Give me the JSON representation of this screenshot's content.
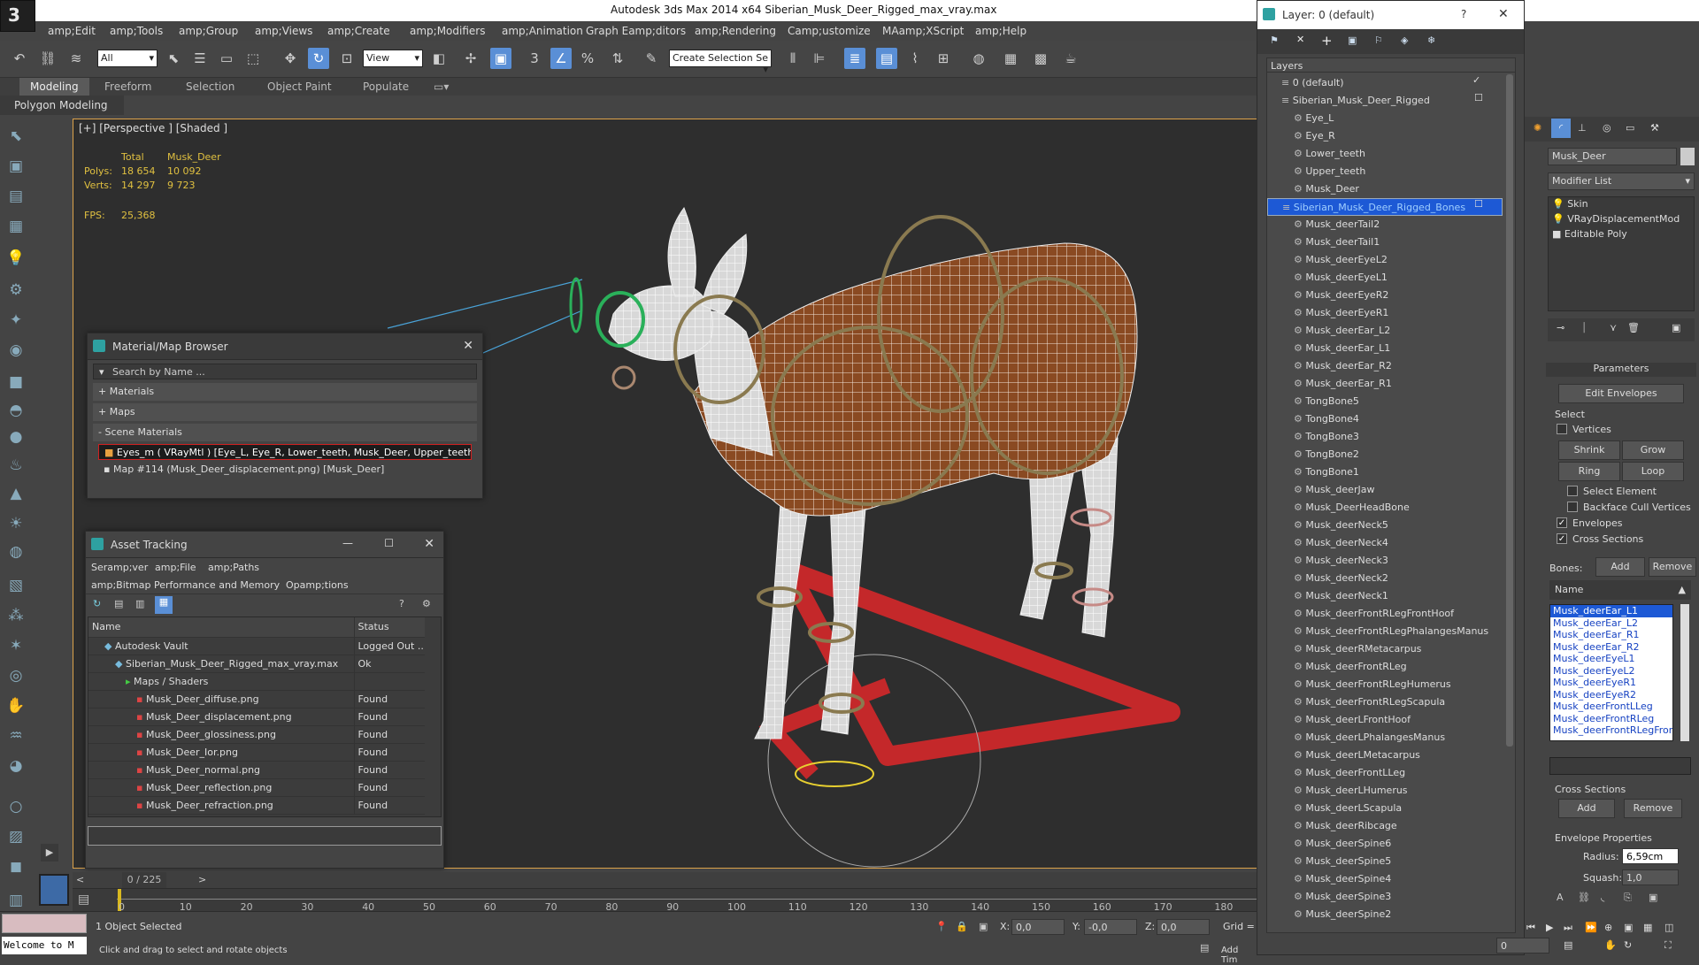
{
  "title": "Autodesk 3ds Max  2014 x64    Siberian_Musk_Deer_Rigged_max_vray.max",
  "logo": "3",
  "menu": [
    "amp;Edit",
    "amp;Tools",
    "amp;Group",
    "amp;Views",
    "amp;Create",
    "amp;Modifiers",
    "amp;Animation",
    "Graph Eamp;ditors",
    "amp;Rendering",
    "Camp;ustomize",
    "MAamp;XScript",
    "amp;Help"
  ],
  "toolbar": {
    "filter": "All",
    "refcoord": "View",
    "selset": "Create Selection Se",
    "snap3": "3",
    "snap_pct": "%"
  },
  "ribbon": {
    "tabs": [
      "Modeling",
      "Freeform",
      "Selection",
      "Object Paint",
      "Populate"
    ],
    "sub": "Polygon Modeling"
  },
  "viewport": {
    "label": "[+] [Perspective ] [Shaded ]",
    "stats": {
      "h_total": "Total",
      "h_obj": "Musk_Deer",
      "polys_label": "Polys:",
      "polys_total": "18 654",
      "polys_obj": "10 092",
      "verts_label": "Verts:",
      "verts_total": "14 297",
      "verts_obj": "9 723",
      "fps_label": "FPS:",
      "fps": "25,368"
    }
  },
  "material_browser": {
    "title": "Material/Map Browser",
    "search": "Search by Name ...",
    "materials": "+ Materials",
    "maps": "+ Maps",
    "scene": "- Scene Materials",
    "items": [
      "Eyes_m  ( VRayMtl ) [Eye_L, Eye_R, Lower_teeth, Musk_Deer, Upper_teeth]",
      "Map #114 (Musk_Deer_displacement.png) [Musk_Deer]"
    ]
  },
  "asset_tracking": {
    "title": "Asset Tracking",
    "menu": [
      "Seramp;ver",
      "amp;File",
      "amp;Paths",
      "amp;Bitmap Performance and Memory",
      "Opamp;tions"
    ],
    "col_name": "Name",
    "col_status": "Status",
    "rows": [
      {
        "name": "Autodesk Vault",
        "status": "Logged Out ..",
        "level": 1
      },
      {
        "name": "Siberian_Musk_Deer_Rigged_max_vray.max",
        "status": "Ok",
        "level": 2
      },
      {
        "name": "Maps / Shaders",
        "status": "",
        "level": 3
      },
      {
        "name": "Musk_Deer_diffuse.png",
        "status": "Found",
        "level": 4
      },
      {
        "name": "Musk_Deer_displacement.png",
        "status": "Found",
        "level": 4
      },
      {
        "name": "Musk_Deer_glossiness.png",
        "status": "Found",
        "level": 4
      },
      {
        "name": "Musk_Deer_Ior.png",
        "status": "Found",
        "level": 4
      },
      {
        "name": "Musk_Deer_normal.png",
        "status": "Found",
        "level": 4
      },
      {
        "name": "Musk_Deer_reflection.png",
        "status": "Found",
        "level": 4
      },
      {
        "name": "Musk_Deer_refraction.png",
        "status": "Found",
        "level": 4
      }
    ]
  },
  "timeline": {
    "frame": "0 / 225",
    "ticks": [
      "0",
      "10",
      "20",
      "30",
      "40",
      "50",
      "60",
      "70",
      "80",
      "90",
      "100",
      "110",
      "120",
      "130",
      "140",
      "150",
      "160",
      "170",
      "180"
    ]
  },
  "status": {
    "welcome": "Welcome to M",
    "selected": "1 Object Selected",
    "hint": "Click and drag to select and rotate objects",
    "x_label": "X:",
    "x": "0,0",
    "y_label": "Y:",
    "y": "-0,0",
    "z_label": "Z:",
    "z": "0,0",
    "grid": "Grid =",
    "addtime": "Add Tim",
    "frame_field": "0"
  },
  "layer_window": {
    "title": "Layer: 0 (default)",
    "help": "?",
    "header": "Layers",
    "rows": [
      "0 (default)",
      "Siberian_Musk_Deer_Rigged",
      "Eye_L",
      "Eye_R",
      "Lower_teeth",
      "Upper_teeth",
      "Musk_Deer",
      "Siberian_Musk_Deer_Rigged_Bones",
      "Musk_deerTail2",
      "Musk_deerTail1",
      "Musk_deerEyeL2",
      "Musk_deerEyeL1",
      "Musk_deerEyeR2",
      "Musk_deerEyeR1",
      "Musk_deerEar_L2",
      "Musk_deerEar_L1",
      "Musk_deerEar_R2",
      "Musk_deerEar_R1",
      "TongBone5",
      "TongBone4",
      "TongBone3",
      "TongBone2",
      "TongBone1",
      "Musk_deerJaw",
      "Musk_DeerHeadBone",
      "Musk_deerNeck5",
      "Musk_deerNeck4",
      "Musk_deerNeck3",
      "Musk_deerNeck2",
      "Musk_deerNeck1",
      "Musk_deerFrontRLegFrontHoof",
      "Musk_deerFrontRLegPhalangesManus",
      "Musk_deerRMetacarpus",
      "Musk_deerFrontRLeg",
      "Musk_deerFrontRLegHumerus",
      "Musk_deerFrontRLegScapula",
      "Musk_deerLFrontHoof",
      "Musk_deerLPhalangesManus",
      "Musk_deerLMetacarpus",
      "Musk_deerFrontLLeg",
      "Musk_deerLHumerus",
      "Musk_deerLScapula",
      "Musk_deerRibcage",
      "Musk_deerSpine6",
      "Musk_deerSpine5",
      "Musk_deerSpine4",
      "Musk_deerSpine3",
      "Musk_deerSpine2"
    ]
  },
  "command_panel": {
    "object_name": "Musk_Deer",
    "modlist": "Modifier List",
    "stack": [
      "Skin",
      "VRayDisplacementMod",
      "Editable Poly"
    ],
    "params": "Parameters",
    "edit_env": "Edit Envelopes",
    "select": "Select",
    "vertices": "Vertices",
    "shrink": "Shrink",
    "grow": "Grow",
    "ring": "Ring",
    "loop": "Loop",
    "sel_element": "Select Element",
    "backface": "Backface Cull Vertices",
    "envelopes": "Envelopes",
    "cross_sections": "Cross Sections",
    "bones": "Bones:",
    "add": "Add",
    "remove": "Remove",
    "name_col": "Name",
    "bone_list": [
      "Musk_deerEar_L1",
      "Musk_deerEar_L2",
      "Musk_deerEar_R1",
      "Musk_deerEar_R2",
      "Musk_deerEyeL1",
      "Musk_deerEyeL2",
      "Musk_deerEyeR1",
      "Musk_deerEyeR2",
      "Musk_deerFrontLLeg",
      "Musk_deerFrontRLeg",
      "Musk_deerFrontRLegFrontH"
    ],
    "cs_title": "Cross Sections",
    "env_props": "Envelope Properties",
    "radius_label": "Radius:",
    "radius": "6,59cm",
    "squash_label": "Squash:",
    "squash": "1,0"
  }
}
